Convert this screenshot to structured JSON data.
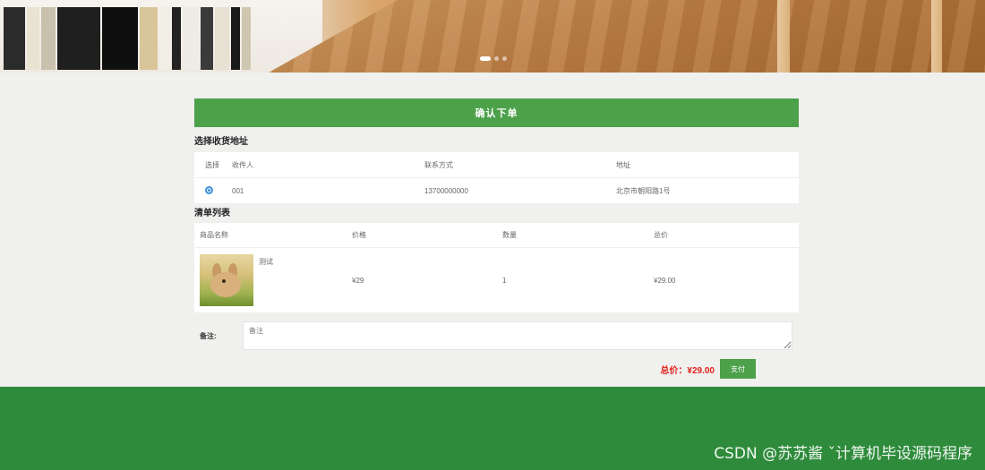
{
  "banner": {
    "slides": 3,
    "active_slide": 1
  },
  "order": {
    "title": "确认下单",
    "address_section_title": "选择收货地址",
    "address_columns": [
      "选择",
      "收件人",
      "联系方式",
      "地址"
    ],
    "addresses": [
      {
        "selected": true,
        "receiver": "001",
        "phone": "13700000000",
        "address": "北京市朝阳路1号"
      }
    ],
    "items_section_title": "清单列表",
    "item_columns": [
      "商品名称",
      "价格",
      "数量",
      "总价"
    ],
    "items": [
      {
        "name": "测试",
        "price": "¥29",
        "quantity": "1",
        "total": "¥29.00"
      }
    ],
    "remark_label": "备注:",
    "remark_placeholder": "备注",
    "total_text": "总价：¥29.00",
    "pay_label": "支付"
  },
  "watermark": "CSDN @苏苏酱   ˇ计算机毕设源码程序",
  "colors": {
    "accent_green": "#4ca14a",
    "footer_green": "#2e8b3b",
    "total_red": "#e2231a",
    "radio_blue": "#3b8fdc"
  }
}
